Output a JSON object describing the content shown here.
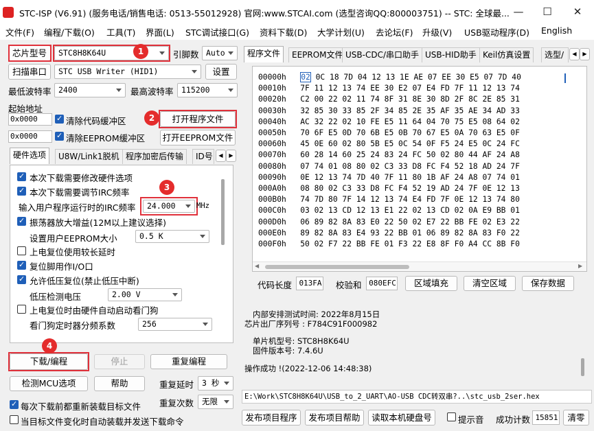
{
  "window": {
    "title": "STC-ISP (V6.91) (服务电话/销售电话: 0513-55012928) 官网:www.STCAI.com  (选型咨询QQ:800003751) -- STC: 全球最...",
    "minimize": "—",
    "maximize": "☐",
    "close": "✕"
  },
  "menu": [
    "文件(F)",
    "编程/下载(O)",
    "工具(T)",
    "界面(L)",
    "STC调试接口(G)",
    "资料下载(D)",
    "大学计划(U)",
    "去论坛(F)",
    "升级(V)",
    "USB驱动程序(D)",
    "English"
  ],
  "left": {
    "chip_button": "芯片型号",
    "chip_value": "STC8H8K64U",
    "pins_label": "引脚数",
    "pins_value": "Auto",
    "scan_button": "扫描串口",
    "port_value": "STC USB Writer (HID1)",
    "settings_button": "设置",
    "min_baud_label": "最低波特率",
    "min_baud_value": "2400",
    "max_baud_label": "最高波特率",
    "max_baud_value": "115200",
    "start_addr_label": "起始地址",
    "addr1": "0x0000",
    "clear_code_label": "清除代码缓冲区",
    "open_program_button": "打开程序文件",
    "addr2": "0x0000",
    "clear_eeprom_label": "清除EEPROM缓冲区",
    "open_eeprom_button": "打开EEPROM文件",
    "tabs": [
      "硬件选项",
      "U8W/Link1脱机",
      "程序加密后传输",
      "ID号"
    ],
    "options": {
      "opt1": "本次下载需要修改硬件选项",
      "opt2": "本次下载需要调节IRC频率",
      "irc_label": "输入用户程序运行时的IRC频率",
      "irc_value": "24.000",
      "irc_unit": "MHz",
      "opt3": "振荡器放大增益(12M以上建议选择)",
      "eeprom_size_label": "设置用户EEPROM大小",
      "eeprom_size_value": "0.5 K",
      "opt4": "上电复位使用较长延时",
      "opt5": "复位脚用作I/O口",
      "opt6": "允许低压复位(禁止低压中断)",
      "lvd_label": "低压检测电压",
      "lvd_value": "2.00 V",
      "opt7": "上电复位时由硬件自动启动看门狗",
      "wdt_label": "看门狗定时器分频系数",
      "wdt_value": "256"
    },
    "download_button": "下载/编程",
    "stop_button": "停止",
    "reprogram_button": "重复编程",
    "check_mcu_button": "检测MCU选项",
    "help_button": "帮助",
    "repeat_delay_label": "重复延时",
    "repeat_delay_value": "3 秒",
    "repeat_count_label": "重复次数",
    "repeat_count_value": "无限",
    "reload_label": "每次下载前都重新装载目标文件",
    "auto_send_label": "当目标文件变化时自动装载并发送下载命令",
    "badges": [
      "1",
      "2",
      "3",
      "4"
    ]
  },
  "right": {
    "tabs": [
      "程序文件",
      "EEPROM文件",
      "USB-CDC/串口助手",
      "USB-HID助手",
      "Keil仿真设置",
      "选型/"
    ],
    "tab_prev": "◀",
    "tab_next": "▶",
    "hex_rows": [
      {
        "addr": "00000h",
        "first": "02",
        "rest": " 0C 18 7D 04 12 13 1E AE 07 EE 30 E5 07 7D 40"
      },
      {
        "addr": "00010h",
        "first": "",
        "rest": "7F 11 12 13 74 EE 30 E2 07 E4 FD 7F 11 12 13 74"
      },
      {
        "addr": "00020h",
        "first": "",
        "rest": "C2 00 22 02 11 74 8F 31 8E 30 8D 2F 8C 2E 85 31"
      },
      {
        "addr": "00030h",
        "first": "",
        "rest": "32 85 30 33 85 2F 34 85 2E 35 AF 35 AE 34 AD 33"
      },
      {
        "addr": "00040h",
        "first": "",
        "rest": "AC 32 22 02 10 FE E5 11 64 04 70 75 E5 08 64 02"
      },
      {
        "addr": "00050h",
        "first": "",
        "rest": "70 6F E5 0D 70 6B E5 0B 70 67 E5 0A 70 63 E5 0F"
      },
      {
        "addr": "00060h",
        "first": "",
        "rest": "45 0E 60 02 80 5B E5 0C 54 0F F5 24 E5 0C 24 FC"
      },
      {
        "addr": "00070h",
        "first": "",
        "rest": "60 28 14 60 25 24 83 24 FC 50 02 80 44 AF 24 A8"
      },
      {
        "addr": "00080h",
        "first": "",
        "rest": "07 74 01 08 80 02 C3 33 D8 FC F4 52 18 AD 24 7F"
      },
      {
        "addr": "00090h",
        "first": "",
        "rest": "0E 12 13 74 7D 40 7F 11 80 1B AF 24 A8 07 74 01"
      },
      {
        "addr": "000A0h",
        "first": "",
        "rest": "08 80 02 C3 33 D8 FC F4 52 19 AD 24 7F 0E 12 13"
      },
      {
        "addr": "000B0h",
        "first": "",
        "rest": "74 7D 80 7F 14 12 13 74 E4 FD 7F 0E 12 13 74 80"
      },
      {
        "addr": "000C0h",
        "first": "",
        "rest": "03 02 13 CD 12 13 E1 22 02 13 CD 02 0A E9 BB 01"
      },
      {
        "addr": "000D0h",
        "first": "",
        "rest": "06 89 82 8A 83 E0 22 50 02 E7 22 BB FE 02 E3 22"
      },
      {
        "addr": "000E0h",
        "first": "",
        "rest": "89 82 8A 83 E4 93 22 BB 01 06 89 82 8A 83 F0 22"
      },
      {
        "addr": "000F0h",
        "first": "",
        "rest": "50 02 F7 22 BB FE 01 F3 22 E8 8F F0 A4 CC 8B F0"
      }
    ],
    "code_len_label": "代码长度",
    "code_len_value": "013FA",
    "checksum_label": "校验和",
    "checksum_value": "080EFC",
    "fill_button": "区域填充",
    "clear_area_button": "清空区域",
    "save_data_button": "保存数据",
    "info": {
      "line1": "内部安排测试时间: 2022年8月15日",
      "line2": "芯片出厂序列号 : F784C91F000982",
      "line3": "单片机型号: STC8H8K64U",
      "line4": "固件版本号: 7.4.6U",
      "line5": "操作成功 !(2022-12-06 14:48:38)"
    },
    "file_path": "E:\\Work\\STC8H8K64U\\USB_to_2_UART\\AO-USB CDC转双串?..\\stc_usb_2ser.hex",
    "publish_program_button": "发布项目程序",
    "publish_help_button": "发布项目帮助",
    "read_disk_button": "读取本机硬盘号",
    "beep_label": "提示音",
    "success_count_label": "成功计数",
    "success_count_value": "15851",
    "clear_button": "清零"
  }
}
